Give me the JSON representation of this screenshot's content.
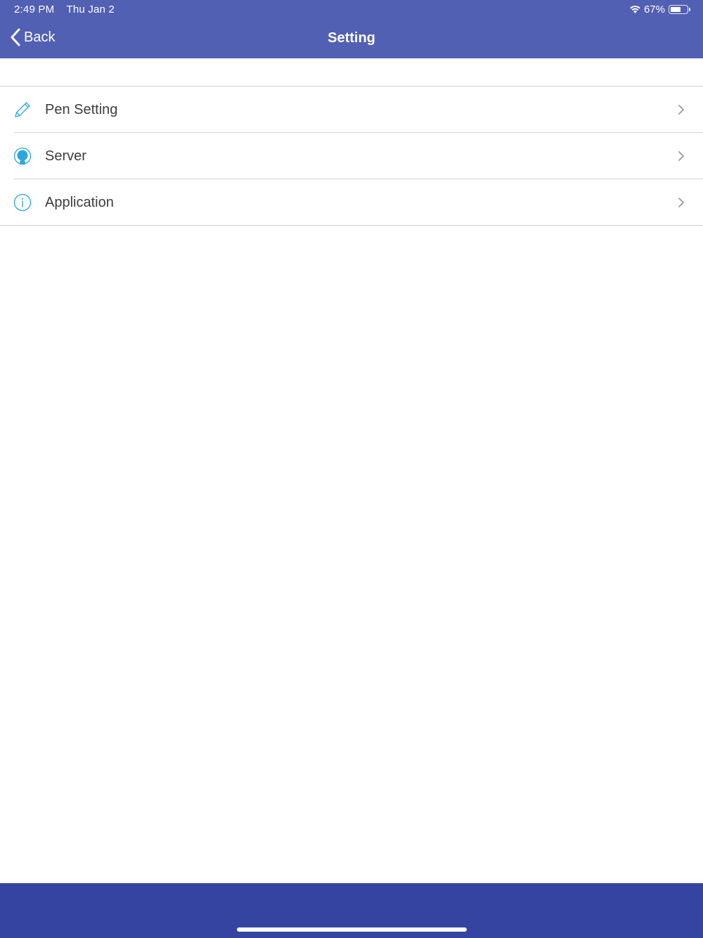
{
  "status_bar": {
    "time": "2:49 PM",
    "date": "Thu Jan 2",
    "battery": "67%",
    "wifi_icon": "wifi-icon",
    "battery_level": 0.67
  },
  "nav": {
    "back_label": "Back",
    "title": "Setting"
  },
  "settings": {
    "items": [
      {
        "label": "Pen Setting",
        "icon": "pencil-icon"
      },
      {
        "label": "Server",
        "icon": "user-icon"
      },
      {
        "label": "Application",
        "icon": "info-icon"
      }
    ]
  },
  "colors": {
    "header": "#5260b3",
    "footer": "#3544a0",
    "icon_accent": "#29a8e0",
    "label": "#3d3d3d",
    "separator": "#d4d4d8"
  }
}
